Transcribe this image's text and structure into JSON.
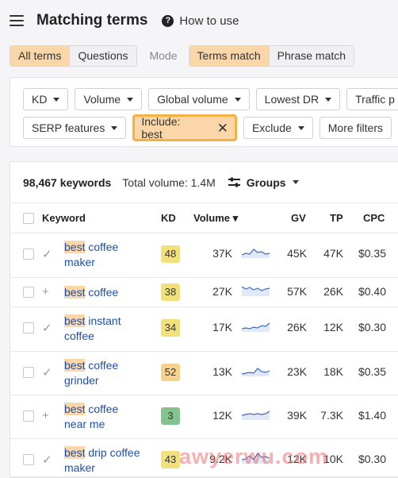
{
  "header": {
    "title": "Matching terms",
    "help_label": "How to use"
  },
  "mode_tabs": {
    "tabs": [
      "All terms",
      "Questions"
    ],
    "mode_label": "Mode",
    "mode_options": [
      "Terms match",
      "Phrase match"
    ]
  },
  "filters": {
    "row1": [
      "KD",
      "Volume",
      "Global volume",
      "Lowest DR",
      "Traffic p"
    ],
    "row2": [
      "SERP features"
    ],
    "include_label": "Include: best",
    "row2b": [
      "Exclude"
    ],
    "more_label": "More filters"
  },
  "summary": {
    "count": "98,467 keywords",
    "volume": "Total volume: 1.4M",
    "groups": "Groups"
  },
  "columns": {
    "keyword": "Keyword",
    "kd": "KD",
    "volume": "Volume ▾",
    "gv": "GV",
    "tp": "TP",
    "cpc": "CPC"
  },
  "colors": {
    "accent": "#fbd6a8",
    "link": "#1f4fa3",
    "kd_yellow": "#f2e07a",
    "kd_green": "#84c38e"
  },
  "rows": [
    {
      "kw_hl": "best",
      "kw_rest1": " coffee",
      "kw_line2": "maker",
      "kd": "48",
      "kd_color": "#f2e07a",
      "volume": "37K",
      "gv": "45K",
      "tp": "47K",
      "cpc": "$0.35",
      "action": "✓"
    },
    {
      "kw_hl": "best",
      "kw_rest1": " coffee",
      "kw_line2": "",
      "kd": "38",
      "kd_color": "#f2e07a",
      "volume": "27K",
      "gv": "57K",
      "tp": "26K",
      "cpc": "$0.40",
      "action": "+"
    },
    {
      "kw_hl": "best",
      "kw_rest1": " instant",
      "kw_line2": "coffee",
      "kd": "34",
      "kd_color": "#f2e07a",
      "volume": "17K",
      "gv": "26K",
      "tp": "12K",
      "cpc": "$0.30",
      "action": "✓"
    },
    {
      "kw_hl": "best",
      "kw_rest1": " coffee",
      "kw_line2": "grinder",
      "kd": "52",
      "kd_color": "#f7d28a",
      "volume": "13K",
      "gv": "23K",
      "tp": "18K",
      "cpc": "$0.35",
      "action": "✓"
    },
    {
      "kw_hl": "best",
      "kw_rest1": " coffee",
      "kw_line2": "near me",
      "kd": "3",
      "kd_color": "#84c38e",
      "volume": "12K",
      "gv": "39K",
      "tp": "7.3K",
      "cpc": "$1.40",
      "action": "+"
    },
    {
      "kw_hl": "best",
      "kw_rest1": " drip coffee",
      "kw_line2": "maker",
      "kd": "43",
      "kd_color": "#f2e07a",
      "volume": "9.2K",
      "gv": "12K",
      "tp": "10K",
      "cpc": "$0.30",
      "action": "✓"
    }
  ],
  "watermark": "awyerwu.com"
}
